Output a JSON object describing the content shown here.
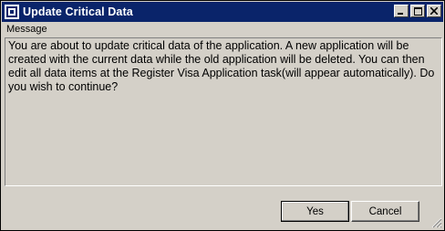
{
  "window": {
    "title": "Update Critical Data",
    "app_icon": "application-icon",
    "controls": [
      "minimize-icon",
      "maximize-icon",
      "close-icon"
    ]
  },
  "panel": {
    "header": "Message",
    "text": "You are about to update critical data of the application. A new application will be created with the current data while the old application will be deleted. You can then edit all data items at the Register Visa Application task(will appear automatically). Do you wish to continue?"
  },
  "buttons": {
    "yes_label": "Yes",
    "cancel_label": "Cancel"
  },
  "colors": {
    "titlebar": "#0a246a",
    "face": "#d4d0c8"
  }
}
